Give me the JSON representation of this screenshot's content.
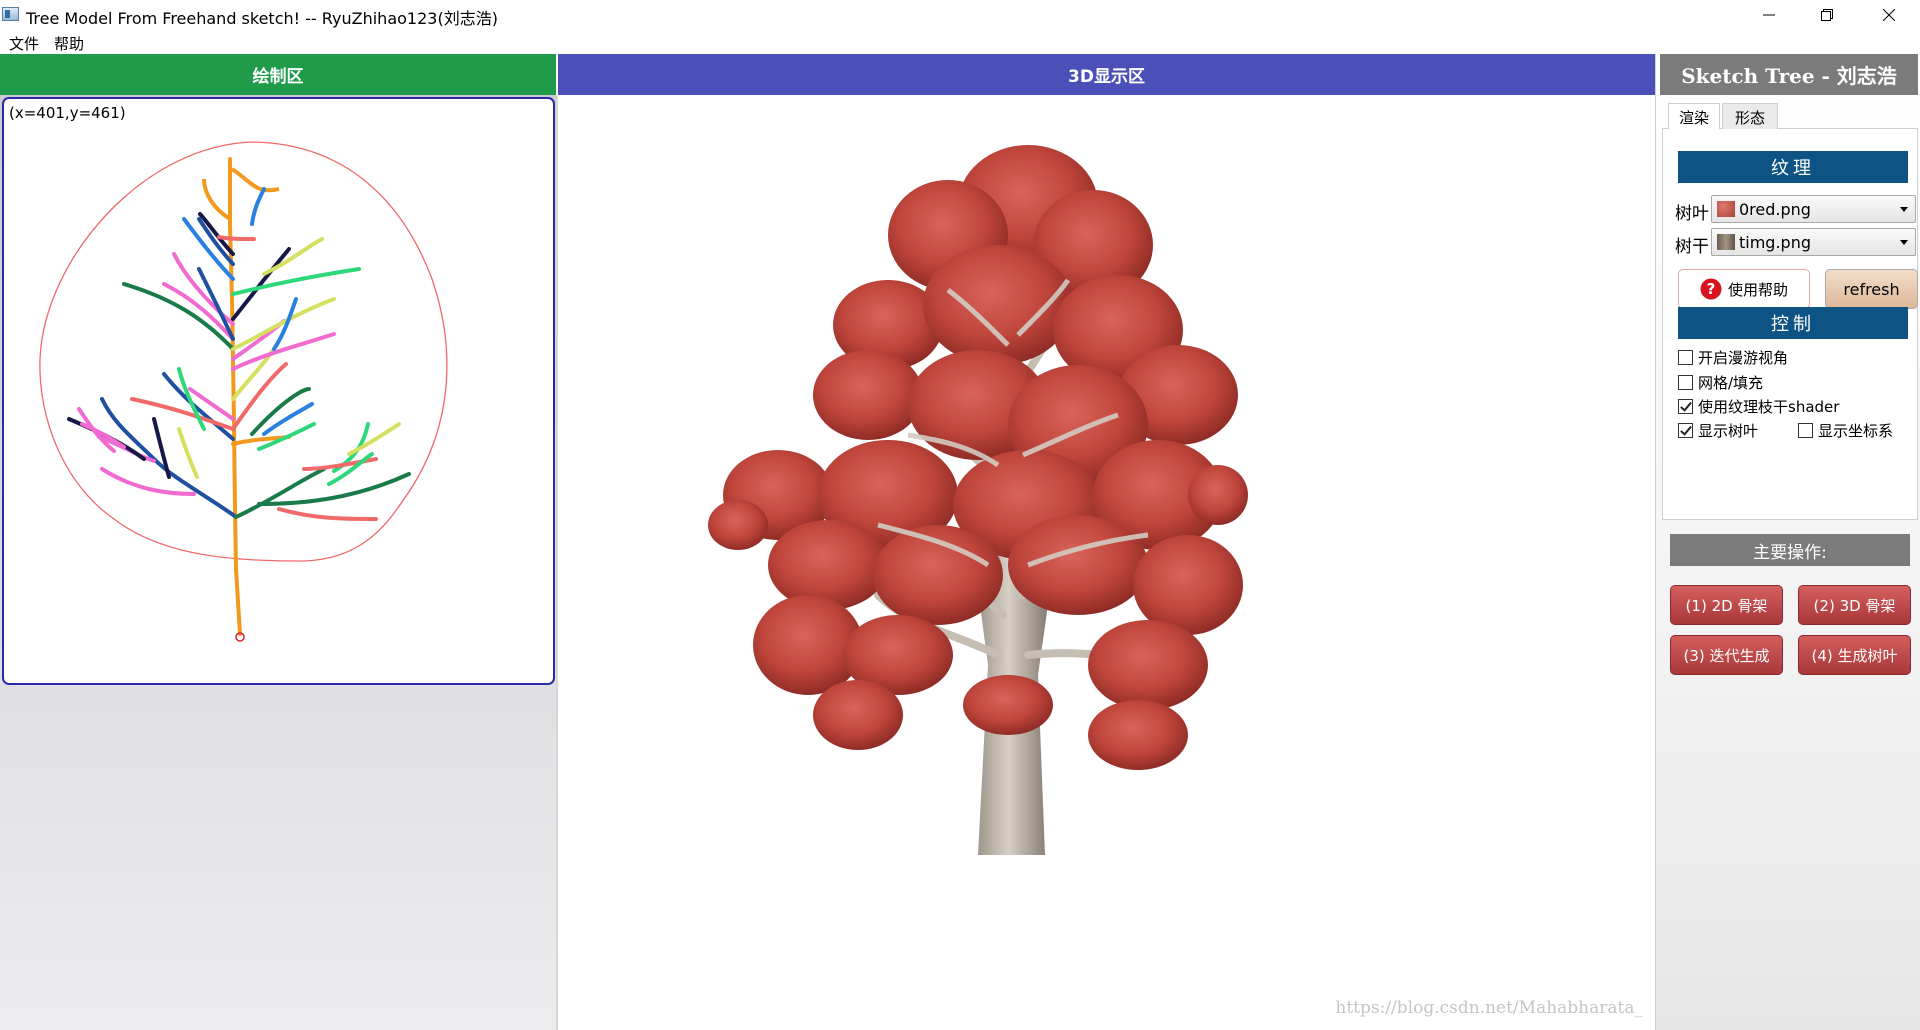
{
  "window": {
    "title": "Tree Model From Freehand sketch! -- RyuZhihao123(刘志浩)"
  },
  "menu": {
    "items": [
      "文件",
      "帮助"
    ]
  },
  "draw_panel": {
    "header": "绘制区",
    "coords": "(x=401,y=461)"
  },
  "view_panel": {
    "header": "3D显示区",
    "watermark": "https://blog.csdn.net/Mahabharata_"
  },
  "right_panel": {
    "brand": "Sketch Tree - 刘志浩",
    "tabs": [
      "渲染",
      "形态"
    ],
    "texture_header": "纹理",
    "leaf_label": "树叶",
    "leaf_value": "0red.png",
    "trunk_label": "树干",
    "trunk_value": "timg.png",
    "help_label": "使用帮助",
    "refresh_label": "refresh",
    "control_header": "控制",
    "checks": [
      {
        "label": "开启漫游视角",
        "checked": false
      },
      {
        "label": "网格/填充",
        "checked": false
      },
      {
        "label": "使用纹理枝干shader",
        "checked": true
      },
      {
        "label": "显示树叶",
        "checked": true
      },
      {
        "label": "显示坐标系",
        "checked": false
      }
    ],
    "ops_header": "主要操作:",
    "ops": [
      "(1) 2D 骨架",
      "(2) 3D 骨架",
      "(3) 迭代生成",
      "(4) 生成树叶"
    ]
  },
  "colors": {
    "draw_header": "#1f9b49",
    "view_header": "#4b4fb8",
    "brand_bg": "#7b7b7b",
    "section_bar": "#0d5383",
    "op_button": "#c04848"
  }
}
